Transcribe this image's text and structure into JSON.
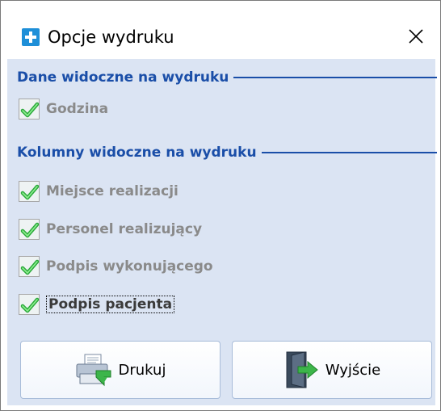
{
  "window": {
    "title": "Opcje wydruku"
  },
  "groups": {
    "visible_data": {
      "title": "Dane widoczne na wydruku",
      "items": [
        {
          "label": "Godzina",
          "checked": true
        }
      ]
    },
    "visible_columns": {
      "title": "Kolumny widoczne na wydruku",
      "items": [
        {
          "label": "Miejsce realizacji",
          "checked": true
        },
        {
          "label": "Personel realizujący",
          "checked": true
        },
        {
          "label": "Podpis wykonującego",
          "checked": true
        },
        {
          "label": "Podpis pacjenta",
          "checked": true
        }
      ]
    }
  },
  "buttons": {
    "print": "Drukuj",
    "exit": "Wyjście"
  },
  "icons": {
    "app": "plus-icon",
    "close": "close-icon",
    "check": "green-check-icon",
    "print": "printer-icon",
    "exit": "exit-door-icon"
  },
  "colors": {
    "accent": "#1a4ea8",
    "panel": "#dbe4f3",
    "check": "#3cc64a"
  }
}
